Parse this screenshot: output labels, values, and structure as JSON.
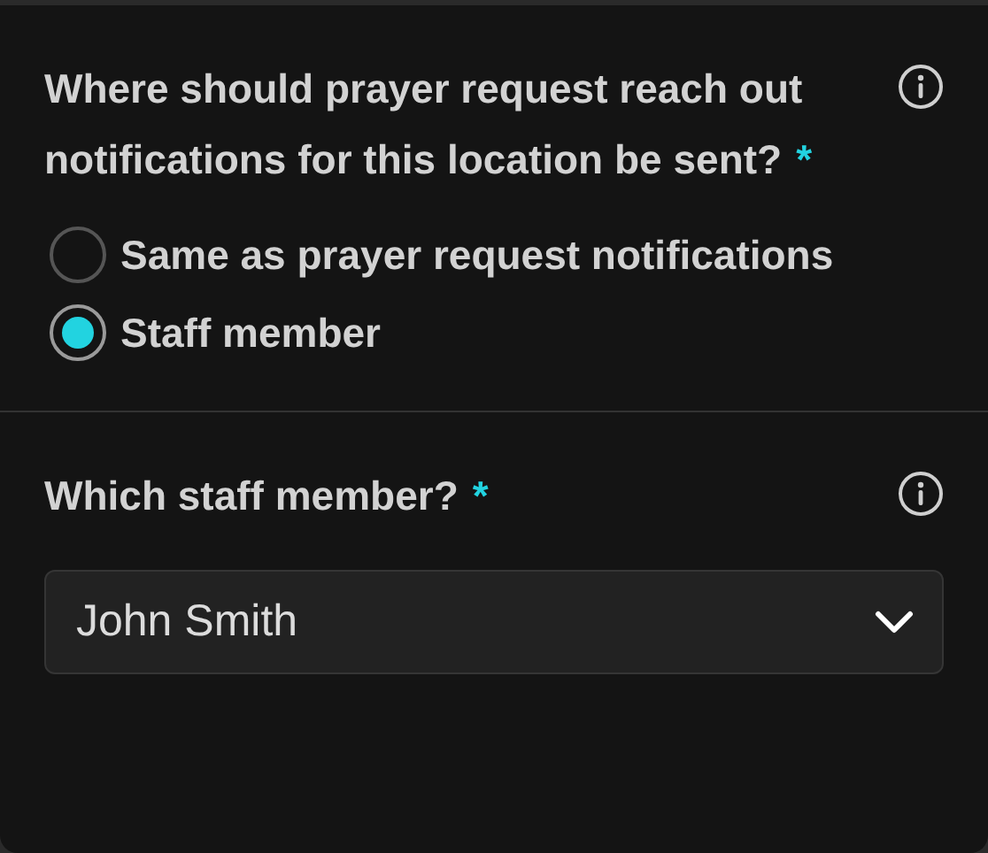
{
  "sections": [
    {
      "kind": "radio",
      "label": "Where should prayer request reach out notifications for this location be sent?",
      "required_mark": "*",
      "options": [
        {
          "label": "Same as prayer request notifications",
          "selected": false
        },
        {
          "label": "Staff member",
          "selected": true
        }
      ]
    },
    {
      "kind": "select",
      "label": "Which staff member?",
      "required_mark": "*",
      "value": "John Smith"
    }
  ]
}
